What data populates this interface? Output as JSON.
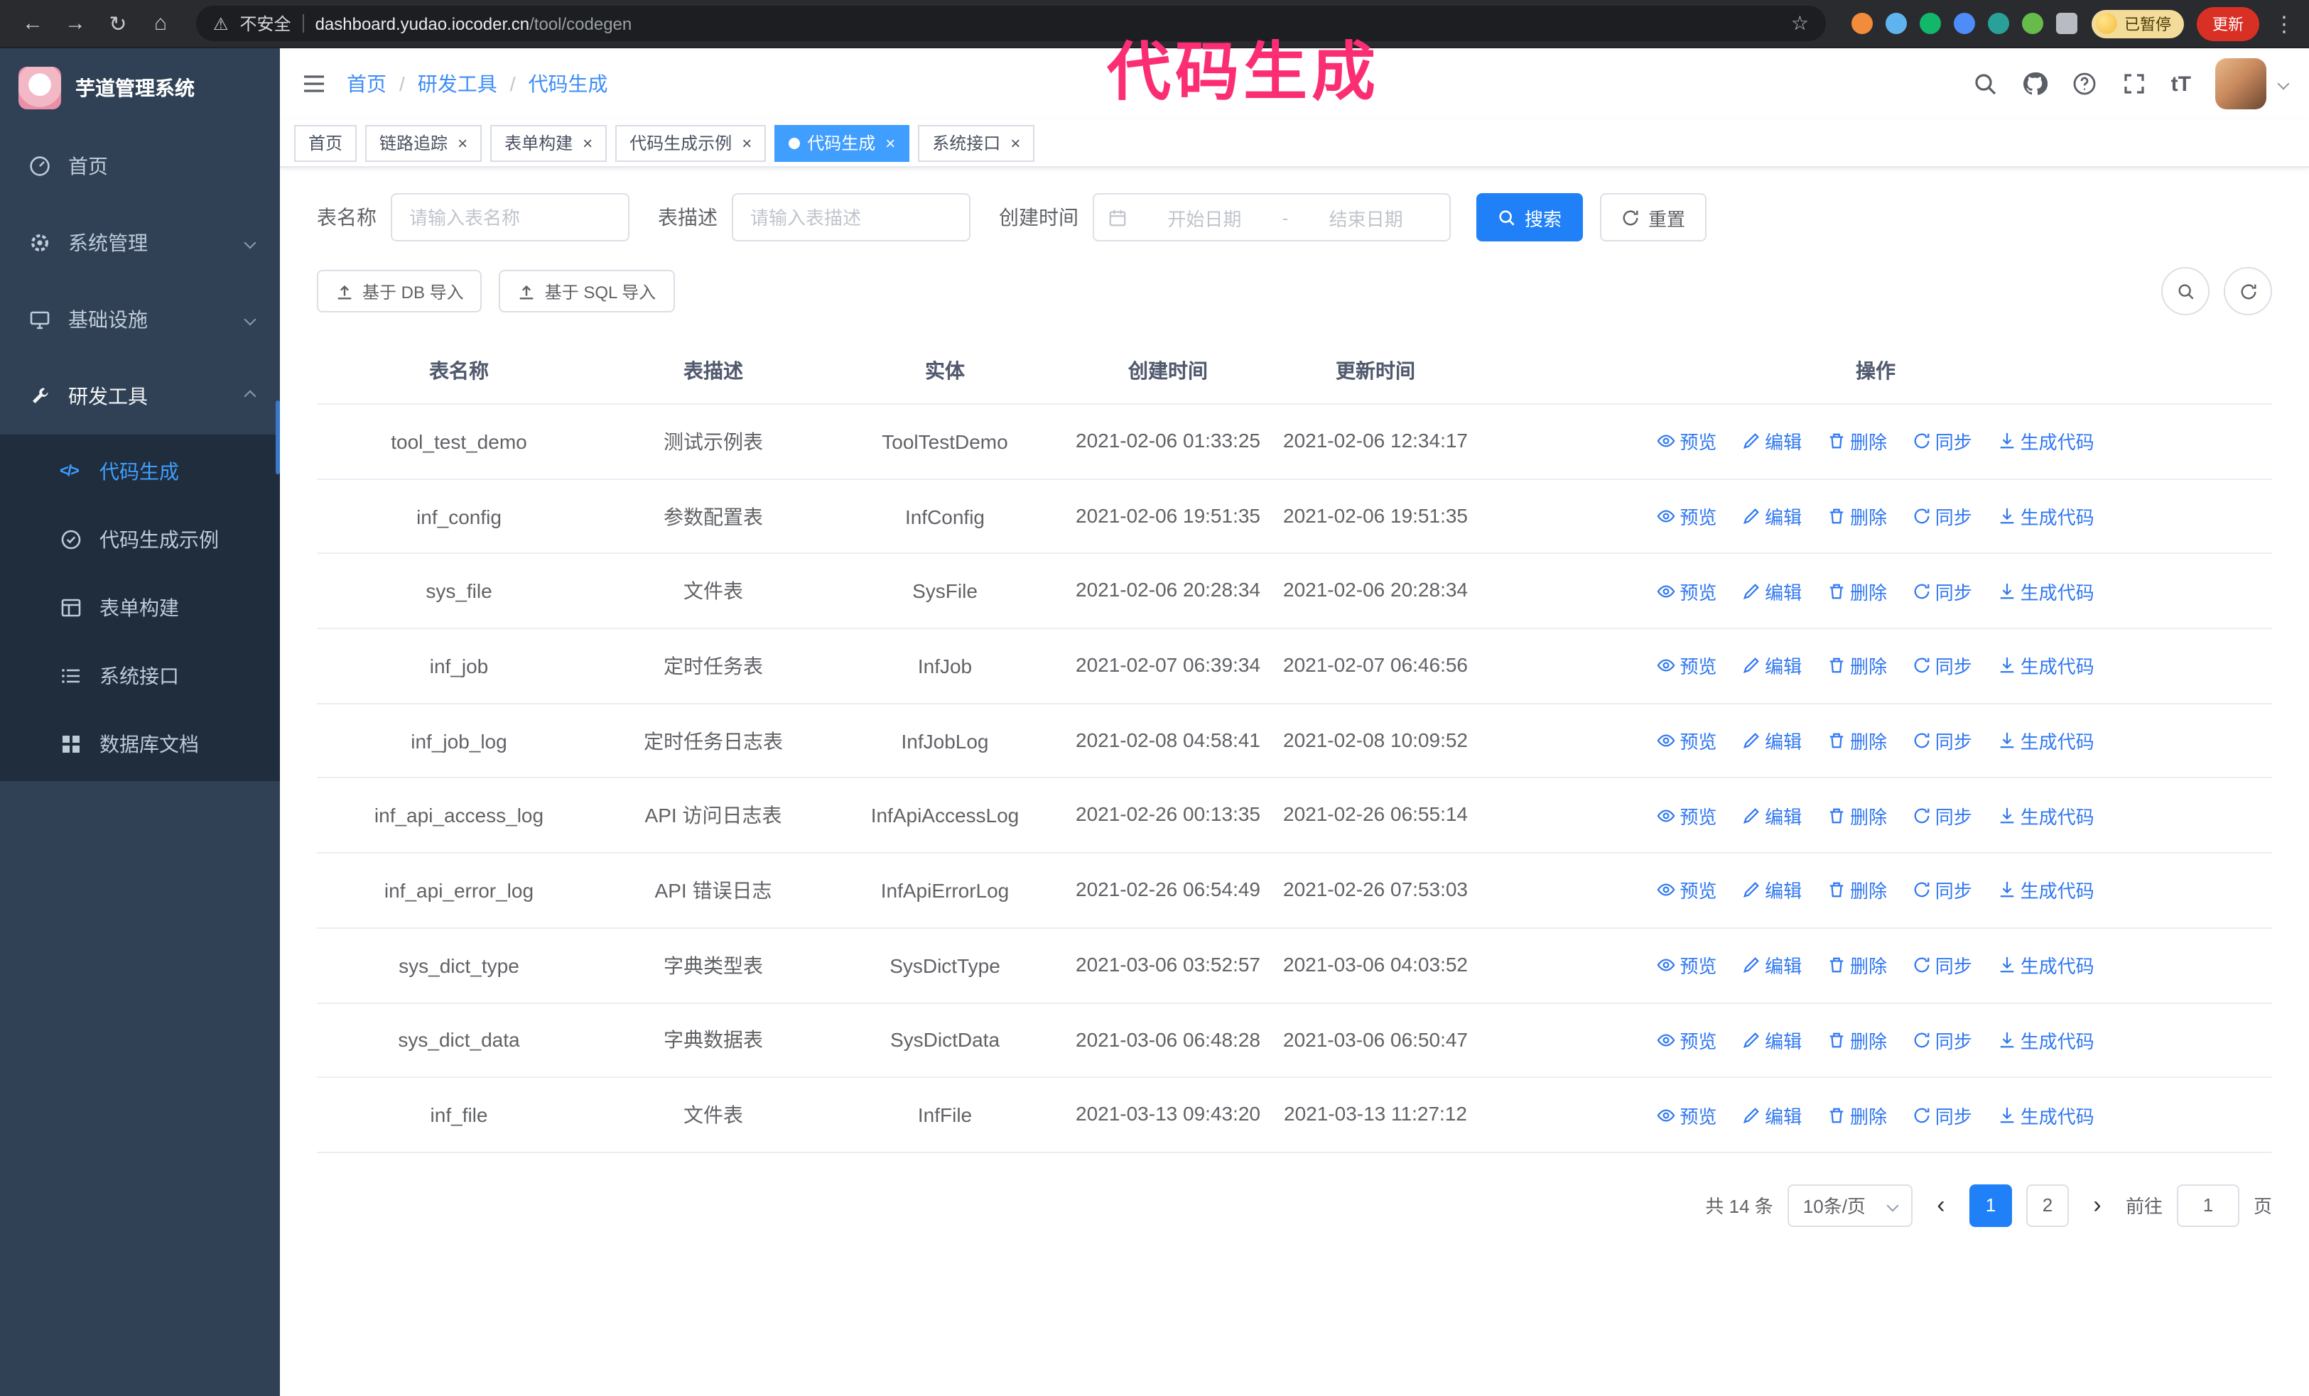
{
  "annotation": {
    "text": "代码生成"
  },
  "browser": {
    "not_secure_label": "不安全",
    "url_host": "dashboard.yudao.iocoder.cn",
    "url_path": "/tool/codegen",
    "paused_badge": "已暂停",
    "update_button": "更新"
  },
  "icons": {
    "back": "←",
    "forward": "→",
    "reload": "↻",
    "home": "⌂",
    "warning": "⚠",
    "star": "☆",
    "kebab": "⋮",
    "font_size": "tT",
    "code": "</>"
  },
  "ui": {
    "close_glyph": "×",
    "breadcrumb_separator": "/"
  },
  "sidebar": {
    "logo_title": "芋道管理系统",
    "items": [
      {
        "label": "首页"
      },
      {
        "label": "系统管理"
      },
      {
        "label": "基础设施"
      },
      {
        "label": "研发工具"
      }
    ],
    "subitems": [
      {
        "label": "代码生成",
        "active": true
      },
      {
        "label": "代码生成示例"
      },
      {
        "label": "表单构建"
      },
      {
        "label": "系统接口"
      },
      {
        "label": "数据库文档"
      }
    ]
  },
  "navbar": {
    "breadcrumb": [
      "首页",
      "研发工具",
      "代码生成"
    ]
  },
  "tabs": [
    {
      "label": "首页"
    },
    {
      "label": "链路追踪"
    },
    {
      "label": "表单构建"
    },
    {
      "label": "代码生成示例"
    },
    {
      "label": "代码生成",
      "active": true
    },
    {
      "label": "系统接口"
    }
  ],
  "filters": {
    "table_name_label": "表名称",
    "table_name_placeholder": "请输入表名称",
    "table_desc_label": "表描述",
    "table_desc_placeholder": "请输入表描述",
    "create_time_label": "创建时间",
    "date_start_placeholder": "开始日期",
    "date_separator": "-",
    "date_end_placeholder": "结束日期",
    "search_button": "搜索",
    "reset_button": "重置"
  },
  "toolbar": {
    "import_db": "基于 DB 导入",
    "import_sql": "基于 SQL 导入"
  },
  "table": {
    "columns": [
      "表名称",
      "表描述",
      "实体",
      "创建时间",
      "更新时间",
      "操作"
    ],
    "actions": [
      "预览",
      "编辑",
      "删除",
      "同步",
      "生成代码"
    ],
    "rows": [
      {
        "name": "tool_test_demo",
        "desc": "测试示例表",
        "entity": "ToolTestDemo",
        "created": "2021-02-06 01:33:25",
        "updated": "2021-02-06 12:34:17"
      },
      {
        "name": "inf_config",
        "desc": "参数配置表",
        "entity": "InfConfig",
        "created": "2021-02-06 19:51:35",
        "updated": "2021-02-06 19:51:35"
      },
      {
        "name": "sys_file",
        "desc": "文件表",
        "entity": "SysFile",
        "created": "2021-02-06 20:28:34",
        "updated": "2021-02-06 20:28:34"
      },
      {
        "name": "inf_job",
        "desc": "定时任务表",
        "entity": "InfJob",
        "created": "2021-02-07 06:39:34",
        "updated": "2021-02-07 06:46:56"
      },
      {
        "name": "inf_job_log",
        "desc": "定时任务日志表",
        "entity": "InfJobLog",
        "created": "2021-02-08 04:58:41",
        "updated": "2021-02-08 10:09:52"
      },
      {
        "name": "inf_api_access_log",
        "desc": "API 访问日志表",
        "entity": "InfApiAccessLog",
        "created": "2021-02-26 00:13:35",
        "updated": "2021-02-26 06:55:14"
      },
      {
        "name": "inf_api_error_log",
        "desc": "API 错误日志",
        "entity": "InfApiErrorLog",
        "created": "2021-02-26 06:54:49",
        "updated": "2021-02-26 07:53:03"
      },
      {
        "name": "sys_dict_type",
        "desc": "字典类型表",
        "entity": "SysDictType",
        "created": "2021-03-06 03:52:57",
        "updated": "2021-03-06 04:03:52"
      },
      {
        "name": "sys_dict_data",
        "desc": "字典数据表",
        "entity": "SysDictData",
        "created": "2021-03-06 06:48:28",
        "updated": "2021-03-06 06:50:47"
      },
      {
        "name": "inf_file",
        "desc": "文件表",
        "entity": "InfFile",
        "created": "2021-03-13 09:43:20",
        "updated": "2021-03-13 11:27:12"
      }
    ]
  },
  "pagination": {
    "total": "共 14 条",
    "page_size": "10条/页",
    "prev_glyph": "‹",
    "next_glyph": "›",
    "pages": [
      "1",
      "2"
    ],
    "active_page": "1",
    "goto_label": "前往",
    "goto_value": "1",
    "goto_suffix": "页"
  },
  "colors": {
    "primary": "#2080f7",
    "active_tab": "#409eff",
    "sidebar_bg": "#304156",
    "submenu_bg": "#1f2d3d",
    "annotation": "#fb2e74",
    "link": "#2f77f1"
  }
}
